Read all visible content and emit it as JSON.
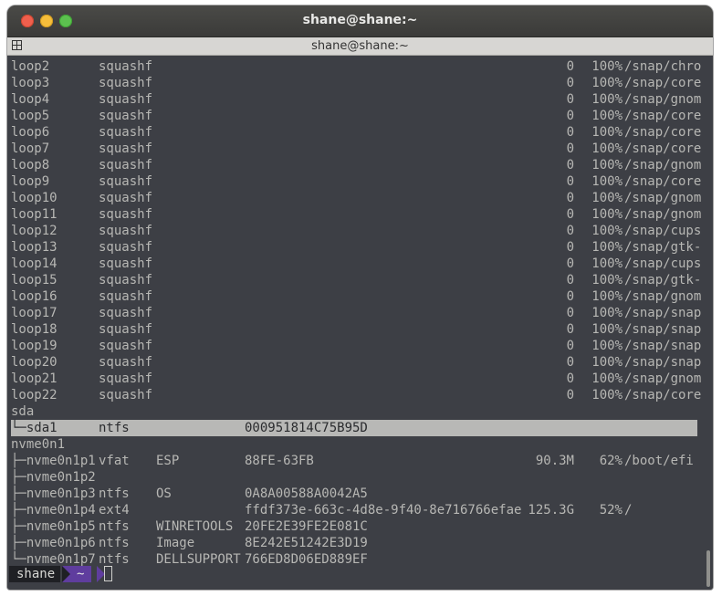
{
  "window": {
    "title": "shane@shane:~"
  },
  "tab": {
    "title": "shane@shane:~"
  },
  "rows": [
    {
      "name": "loop2",
      "fs": "squashf",
      "label": "",
      "uuid": "",
      "avail": "0",
      "use": "100%",
      "mount": "/snap/chro"
    },
    {
      "name": "loop3",
      "fs": "squashf",
      "label": "",
      "uuid": "",
      "avail": "0",
      "use": "100%",
      "mount": "/snap/core"
    },
    {
      "name": "loop4",
      "fs": "squashf",
      "label": "",
      "uuid": "",
      "avail": "0",
      "use": "100%",
      "mount": "/snap/gnom"
    },
    {
      "name": "loop5",
      "fs": "squashf",
      "label": "",
      "uuid": "",
      "avail": "0",
      "use": "100%",
      "mount": "/snap/core"
    },
    {
      "name": "loop6",
      "fs": "squashf",
      "label": "",
      "uuid": "",
      "avail": "0",
      "use": "100%",
      "mount": "/snap/core"
    },
    {
      "name": "loop7",
      "fs": "squashf",
      "label": "",
      "uuid": "",
      "avail": "0",
      "use": "100%",
      "mount": "/snap/core"
    },
    {
      "name": "loop8",
      "fs": "squashf",
      "label": "",
      "uuid": "",
      "avail": "0",
      "use": "100%",
      "mount": "/snap/gnom"
    },
    {
      "name": "loop9",
      "fs": "squashf",
      "label": "",
      "uuid": "",
      "avail": "0",
      "use": "100%",
      "mount": "/snap/core"
    },
    {
      "name": "loop10",
      "fs": "squashf",
      "label": "",
      "uuid": "",
      "avail": "0",
      "use": "100%",
      "mount": "/snap/gnom"
    },
    {
      "name": "loop11",
      "fs": "squashf",
      "label": "",
      "uuid": "",
      "avail": "0",
      "use": "100%",
      "mount": "/snap/gnom"
    },
    {
      "name": "loop12",
      "fs": "squashf",
      "label": "",
      "uuid": "",
      "avail": "0",
      "use": "100%",
      "mount": "/snap/cups"
    },
    {
      "name": "loop13",
      "fs": "squashf",
      "label": "",
      "uuid": "",
      "avail": "0",
      "use": "100%",
      "mount": "/snap/gtk-"
    },
    {
      "name": "loop14",
      "fs": "squashf",
      "label": "",
      "uuid": "",
      "avail": "0",
      "use": "100%",
      "mount": "/snap/cups"
    },
    {
      "name": "loop15",
      "fs": "squashf",
      "label": "",
      "uuid": "",
      "avail": "0",
      "use": "100%",
      "mount": "/snap/gtk-"
    },
    {
      "name": "loop16",
      "fs": "squashf",
      "label": "",
      "uuid": "",
      "avail": "0",
      "use": "100%",
      "mount": "/snap/gnom"
    },
    {
      "name": "loop17",
      "fs": "squashf",
      "label": "",
      "uuid": "",
      "avail": "0",
      "use": "100%",
      "mount": "/snap/snap"
    },
    {
      "name": "loop18",
      "fs": "squashf",
      "label": "",
      "uuid": "",
      "avail": "0",
      "use": "100%",
      "mount": "/snap/snap"
    },
    {
      "name": "loop19",
      "fs": "squashf",
      "label": "",
      "uuid": "",
      "avail": "0",
      "use": "100%",
      "mount": "/snap/snap"
    },
    {
      "name": "loop20",
      "fs": "squashf",
      "label": "",
      "uuid": "",
      "avail": "0",
      "use": "100%",
      "mount": "/snap/snap"
    },
    {
      "name": "loop21",
      "fs": "squashf",
      "label": "",
      "uuid": "",
      "avail": "0",
      "use": "100%",
      "mount": "/snap/gnom"
    },
    {
      "name": "loop22",
      "fs": "squashf",
      "label": "",
      "uuid": "",
      "avail": "0",
      "use": "100%",
      "mount": "/snap/core"
    },
    {
      "name": "sda",
      "fs": "",
      "label": "",
      "uuid": "",
      "avail": "",
      "use": "",
      "mount": ""
    },
    {
      "name": "└─sda1",
      "fs": "ntfs",
      "label": "",
      "uuid": "000951814C75B95D",
      "avail": "",
      "use": "",
      "mount": "",
      "highlight": true
    },
    {
      "name": "nvme0n1",
      "fs": "",
      "label": "",
      "uuid": "",
      "avail": "",
      "use": "",
      "mount": ""
    },
    {
      "name": "├─nvme0n1p1",
      "fs": "vfat",
      "label": "ESP",
      "uuid": "88FE-63FB",
      "avail": "90.3M",
      "use": "62%",
      "mount": "/boot/efi"
    },
    {
      "name": "├─nvme0n1p2",
      "fs": "",
      "label": "",
      "uuid": "",
      "avail": "",
      "use": "",
      "mount": ""
    },
    {
      "name": "├─nvme0n1p3",
      "fs": "ntfs",
      "label": "OS",
      "uuid": "0A8A00588A0042A5",
      "avail": "",
      "use": "",
      "mount": ""
    },
    {
      "name": "├─nvme0n1p4",
      "fs": "ext4",
      "label": "",
      "uuid": "ffdf373e-663c-4d8e-9f40-8e716766efae",
      "avail": "125.3G",
      "use": "52%",
      "mount": "/"
    },
    {
      "name": "├─nvme0n1p5",
      "fs": "ntfs",
      "label": "WINRETOOLS",
      "uuid": "20FE2E39FE2E081C",
      "avail": "",
      "use": "",
      "mount": ""
    },
    {
      "name": "├─nvme0n1p6",
      "fs": "ntfs",
      "label": "Image",
      "uuid": "8E242E51242E3D19",
      "avail": "",
      "use": "",
      "mount": ""
    },
    {
      "name": "└─nvme0n1p7",
      "fs": "ntfs",
      "label": "DELLSUPPORT",
      "uuid": "766ED8D06ED889EF",
      "avail": "",
      "use": "",
      "mount": ""
    }
  ],
  "prompt": {
    "user": "shane",
    "dir": "~"
  },
  "colors": {
    "terminal_bg": "#3d3f45",
    "text": "#b7b7b4",
    "highlight_bg": "#b8b8b6",
    "prompt_user_bg": "#1f2024",
    "prompt_dir_bg": "#5f3d9e"
  }
}
